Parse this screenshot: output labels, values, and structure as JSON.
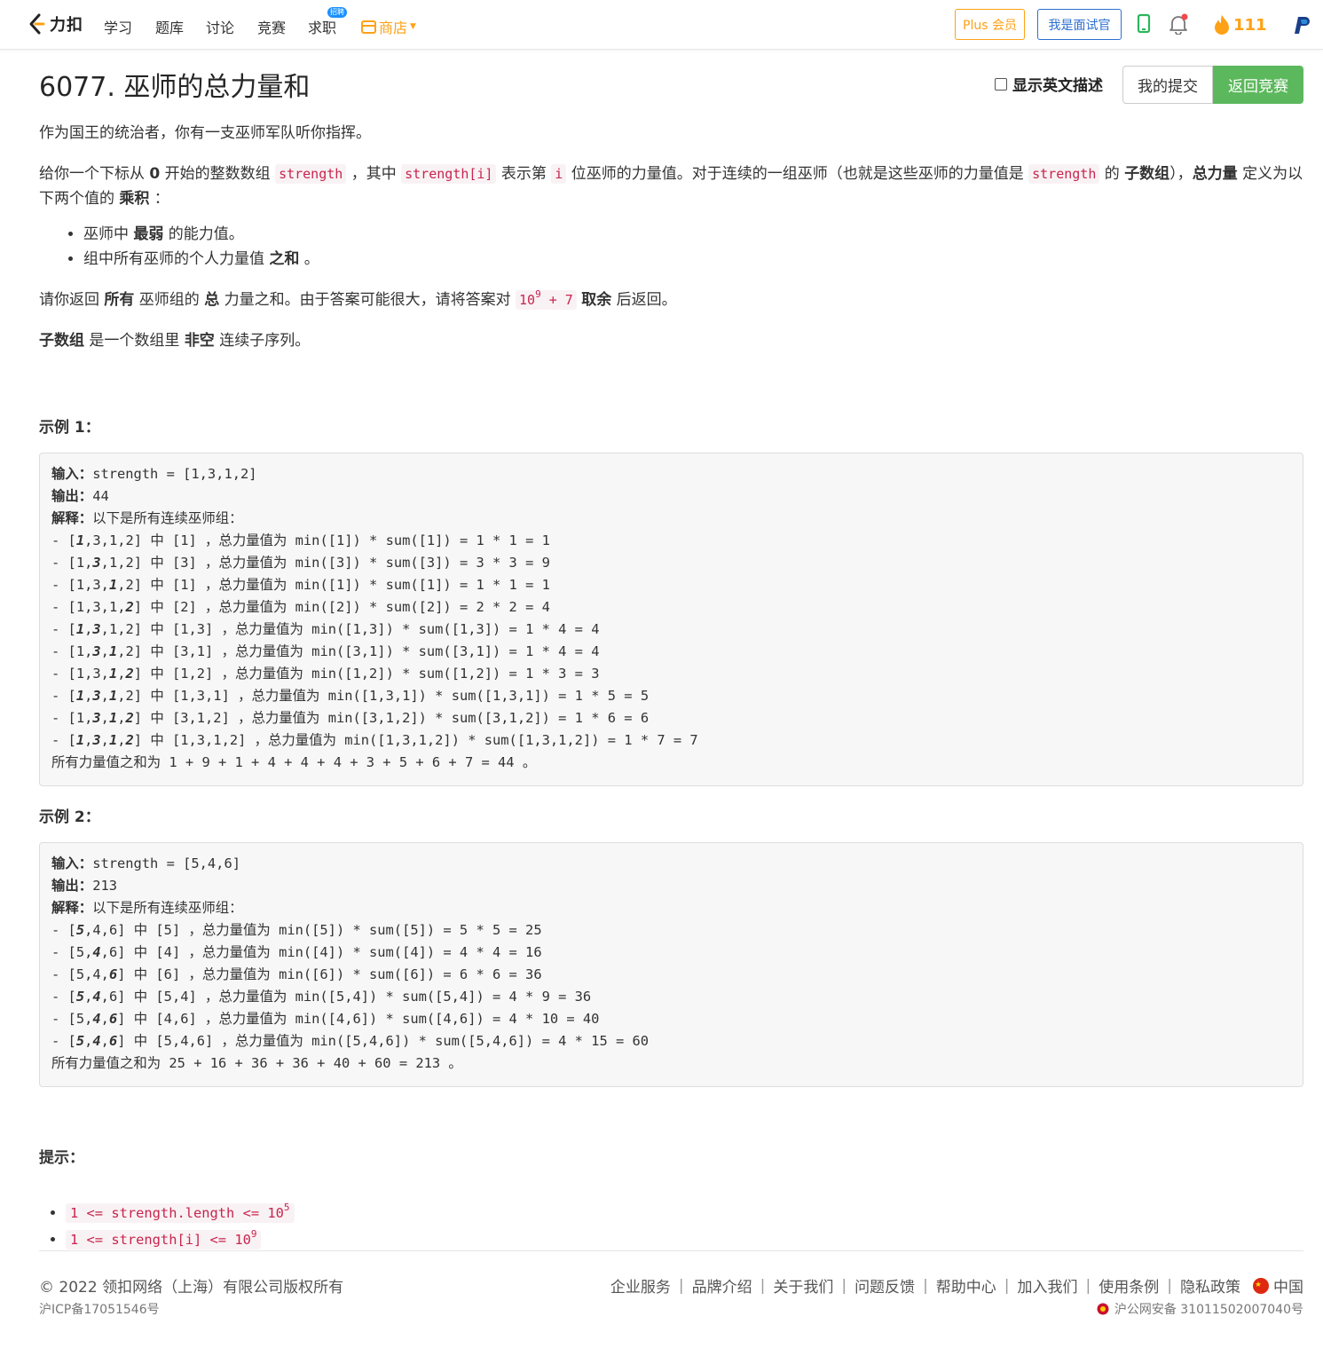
{
  "nav": {
    "brand": "力扣",
    "links": [
      "学习",
      "题库",
      "讨论",
      "竞赛",
      "求职"
    ],
    "jobs_badge": "招聘",
    "shop": "商店",
    "plus": "Plus 会员",
    "interviewer": "我是面试官",
    "streak": "111"
  },
  "problem": {
    "title": "6077. 巫师的总力量和",
    "english_toggle": "显示英文描述",
    "my_submissions": "我的提交",
    "back_to_contest": "返回竞赛",
    "p1": "作为国王的统治者，你有一支巫师军队听你指挥。",
    "p2": {
      "t1": "给你一个下标从 ",
      "b1": "0",
      "t2": " 开始的整数数组 ",
      "c1": "strength",
      "t3": " ，其中 ",
      "c2": "strength[i]",
      "t4": " 表示第 ",
      "c3": "i",
      "t5": " 位巫师的力量值。对于连续的一组巫师（也就是这些巫师的力量值是 ",
      "c4": "strength",
      "t6": " 的 ",
      "b2": "子数组",
      "t7": "），",
      "b3": "总力量",
      "t8": " 定义为以下两个值的 ",
      "b4": "乘积",
      "t9": " ："
    },
    "bullets": [
      {
        "t1": "巫师中 ",
        "b": "最弱",
        "t2": " 的能力值。"
      },
      {
        "t1": "组中所有巫师的个人力量值 ",
        "b": "之和",
        "t2": " 。"
      }
    ],
    "p3": {
      "t1": "请你返回 ",
      "b1": "所有",
      "t2": " 巫师组的 ",
      "b2": "总",
      "t3": " 力量之和。由于答案可能很大，请将答案对 ",
      "c_base": "10",
      "c_exp": "9",
      "c_rest": " + 7",
      "t4": " ",
      "b3": "取余",
      "t5": " 后返回。"
    },
    "p4": {
      "b1": "子数组",
      "t1": " 是一个数组里 ",
      "b2": "非空",
      "t2": " 连续子序列。"
    }
  },
  "example1": {
    "heading": "示例 1：",
    "input_label": "输入：",
    "input": "strength = [1,3,1,2]",
    "output_label": "输出：",
    "output": "44",
    "explain_label": "解释：",
    "explain": "以下是所有连续巫师组：",
    "lines": [
      {
        "pre": "- [",
        "arr": [
          [
            "1",
            true
          ],
          [
            "3",
            false
          ],
          [
            "1",
            false
          ],
          [
            "2",
            false
          ]
        ],
        "post": "] 中 [1] ，总力量值为 min([1]) * sum([1]) = 1 * 1 = 1"
      },
      {
        "pre": "- [",
        "arr": [
          [
            "1",
            false
          ],
          [
            "3",
            true
          ],
          [
            "1",
            false
          ],
          [
            "2",
            false
          ]
        ],
        "post": "] 中 [3] ，总力量值为 min([3]) * sum([3]) = 3 * 3 = 9"
      },
      {
        "pre": "- [",
        "arr": [
          [
            "1",
            false
          ],
          [
            "3",
            false
          ],
          [
            "1",
            true
          ],
          [
            "2",
            false
          ]
        ],
        "post": "] 中 [1] ，总力量值为 min([1]) * sum([1]) = 1 * 1 = 1"
      },
      {
        "pre": "- [",
        "arr": [
          [
            "1",
            false
          ],
          [
            "3",
            false
          ],
          [
            "1",
            false
          ],
          [
            "2",
            true
          ]
        ],
        "post": "] 中 [2] ，总力量值为 min([2]) * sum([2]) = 2 * 2 = 4"
      },
      {
        "pre": "- [",
        "arr": [
          [
            "1",
            true
          ],
          [
            "3",
            true
          ],
          [
            "1",
            false
          ],
          [
            "2",
            false
          ]
        ],
        "post": "] 中 [1,3] ，总力量值为 min([1,3]) * sum([1,3]) = 1 * 4 = 4"
      },
      {
        "pre": "- [",
        "arr": [
          [
            "1",
            false
          ],
          [
            "3",
            true
          ],
          [
            "1",
            true
          ],
          [
            "2",
            false
          ]
        ],
        "post": "] 中 [3,1] ，总力量值为 min([3,1]) * sum([3,1]) = 1 * 4 = 4"
      },
      {
        "pre": "- [",
        "arr": [
          [
            "1",
            false
          ],
          [
            "3",
            false
          ],
          [
            "1",
            true
          ],
          [
            "2",
            true
          ]
        ],
        "post": "] 中 [1,2] ，总力量值为 min([1,2]) * sum([1,2]) = 1 * 3 = 3"
      },
      {
        "pre": "- [",
        "arr": [
          [
            "1",
            true
          ],
          [
            "3",
            true
          ],
          [
            "1",
            true
          ],
          [
            "2",
            false
          ]
        ],
        "post": "] 中 [1,3,1] ，总力量值为 min([1,3,1]) * sum([1,3,1]) = 1 * 5 = 5"
      },
      {
        "pre": "- [",
        "arr": [
          [
            "1",
            false
          ],
          [
            "3",
            true
          ],
          [
            "1",
            true
          ],
          [
            "2",
            true
          ]
        ],
        "post": "] 中 [3,1,2] ，总力量值为 min([3,1,2]) * sum([3,1,2]) = 1 * 6 = 6"
      },
      {
        "pre": "- [",
        "arr": [
          [
            "1",
            true
          ],
          [
            "3",
            true
          ],
          [
            "1",
            true
          ],
          [
            "2",
            true
          ]
        ],
        "post": "] 中 [1,3,1,2] ，总力量值为 min([1,3,1,2]) * sum([1,3,1,2]) = 1 * 7 = 7"
      }
    ],
    "total": "所有力量值之和为 1 + 9 + 1 + 4 + 4 + 4 + 3 + 5 + 6 + 7 = 44 。"
  },
  "example2": {
    "heading": "示例 2：",
    "input_label": "输入：",
    "input": "strength = [5,4,6]",
    "output_label": "输出：",
    "output": "213",
    "explain_label": "解释：",
    "explain": "以下是所有连续巫师组：",
    "lines": [
      {
        "pre": "- [",
        "arr": [
          [
            "5",
            true
          ],
          [
            "4",
            false
          ],
          [
            "6",
            false
          ]
        ],
        "post": "] 中 [5] ，总力量值为 min([5]) * sum([5]) = 5 * 5 = 25"
      },
      {
        "pre": "- [",
        "arr": [
          [
            "5",
            false
          ],
          [
            "4",
            true
          ],
          [
            "6",
            false
          ]
        ],
        "post": "] 中 [4] ，总力量值为 min([4]) * sum([4]) = 4 * 4 = 16"
      },
      {
        "pre": "- [",
        "arr": [
          [
            "5",
            false
          ],
          [
            "4",
            false
          ],
          [
            "6",
            true
          ]
        ],
        "post": "] 中 [6] ，总力量值为 min([6]) * sum([6]) = 6 * 6 = 36"
      },
      {
        "pre": "- [",
        "arr": [
          [
            "5",
            true
          ],
          [
            "4",
            true
          ],
          [
            "6",
            false
          ]
        ],
        "post": "] 中 [5,4] ，总力量值为 min([5,4]) * sum([5,4]) = 4 * 9 = 36"
      },
      {
        "pre": "- [",
        "arr": [
          [
            "5",
            false
          ],
          [
            "4",
            true
          ],
          [
            "6",
            true
          ]
        ],
        "post": "] 中 [4,6] ，总力量值为 min([4,6]) * sum([4,6]) = 4 * 10 = 40"
      },
      {
        "pre": "- [",
        "arr": [
          [
            "5",
            true
          ],
          [
            "4",
            true
          ],
          [
            "6",
            true
          ]
        ],
        "post": "] 中 [5,4,6] ，总力量值为 min([5,4,6]) * sum([5,4,6]) = 4 * 15 = 60"
      }
    ],
    "total": "所有力量值之和为 25 + 16 + 36 + 36 + 40 + 60 = 213 。"
  },
  "hints": {
    "heading": "提示：",
    "items": [
      {
        "text": "1 <= strength.length <= 10",
        "sup": "5"
      },
      {
        "text": "1 <= strength[i] <= 10",
        "sup": "9"
      }
    ]
  },
  "footer": {
    "copyright": "© 2022 领扣网络（上海）有限公司版权所有",
    "icp": "沪ICP备17051546号",
    "links": [
      "企业服务",
      "品牌介绍",
      "关于我们",
      "问题反馈",
      "帮助中心",
      "加入我们",
      "使用条例",
      "隐私政策"
    ],
    "region": "中国",
    "police": "沪公网安备 31011502007040号"
  }
}
